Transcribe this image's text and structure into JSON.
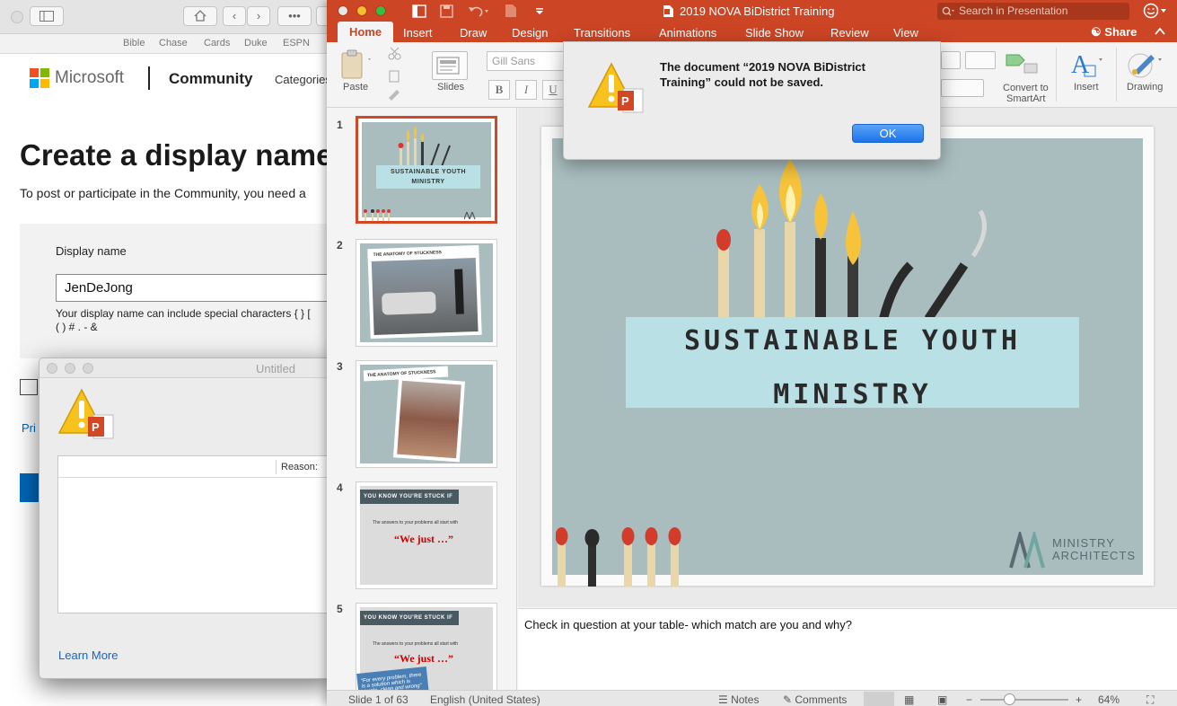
{
  "browser": {
    "bookmarks": [
      "Bible",
      "Chase",
      "Cards",
      "Duke",
      "ESPN"
    ],
    "ms_word": "Microsoft",
    "community": "Community",
    "categories": "Categories",
    "heading": "Create a display name",
    "subheading": "To post or participate in the Community, you need a",
    "display_name_label": "Display name",
    "display_name_value": "JenDeJong",
    "help_line1": "Your display name can include special characters { } [",
    "help_line2": "( ) # . - &",
    "link_partial": "Pri"
  },
  "untitled": {
    "title": "Untitled",
    "reason_header": "Reason:",
    "learn_more": "Learn More"
  },
  "ppt": {
    "window_title": "2019 NOVA BiDistrict Training",
    "search_placeholder": "Search in Presentation",
    "tabs": [
      "Home",
      "Insert",
      "Draw",
      "Design",
      "Transitions",
      "Animations",
      "Slide Show",
      "Review",
      "View"
    ],
    "share": "Share",
    "ribbon": {
      "paste": "Paste",
      "slides": "Slides",
      "font": "Gill Sans",
      "bold": "B",
      "italic": "I",
      "underline": "U",
      "convert1": "Convert to",
      "convert2": "SmartArt",
      "insert": "Insert",
      "drawing": "Drawing"
    },
    "thumbnails": [
      {
        "num": "1",
        "text1": "SUSTAINABLE YOUTH",
        "text2": "MINISTRY"
      },
      {
        "num": "2",
        "text1": "THE ANATOMY OF STUCKNESS"
      },
      {
        "num": "3",
        "text1": "THE ANATOMY OF STUCKNESS"
      },
      {
        "num": "4",
        "text1": "YOU KNOW YOU'RE STUCK IF",
        "text2": "The answers to your problems all start with",
        "text3": "“We just …”"
      },
      {
        "num": "5",
        "text1": "YOU KNOW YOU'RE STUCK IF",
        "text2": "The answers to your problems all start with",
        "text3": "“We just …”",
        "text4": "“For every problem, there is a solution which is simple, clean and wrong”"
      }
    ],
    "slide": {
      "title_line1": "SUSTAINABLE YOUTH",
      "title_line2": "MINISTRY",
      "brand1": "MINISTRY",
      "brand2": "ARCHITECTS"
    },
    "notes": "Check in question at your table- which match are you and why?",
    "status": {
      "slide_count": "Slide 1 of 63",
      "language": "English (United States)",
      "notes": "Notes",
      "comments": "Comments",
      "zoom": "64%"
    }
  },
  "alert": {
    "message": "The document “2019 NOVA BiDistrict Training” could not be saved.",
    "ok": "OK"
  },
  "colors": {
    "ppt_accent": "#cc4525",
    "slide_bg": "#a9bdbf",
    "banner": "#b8e0e5",
    "ok_blue": "#1c72ea"
  }
}
